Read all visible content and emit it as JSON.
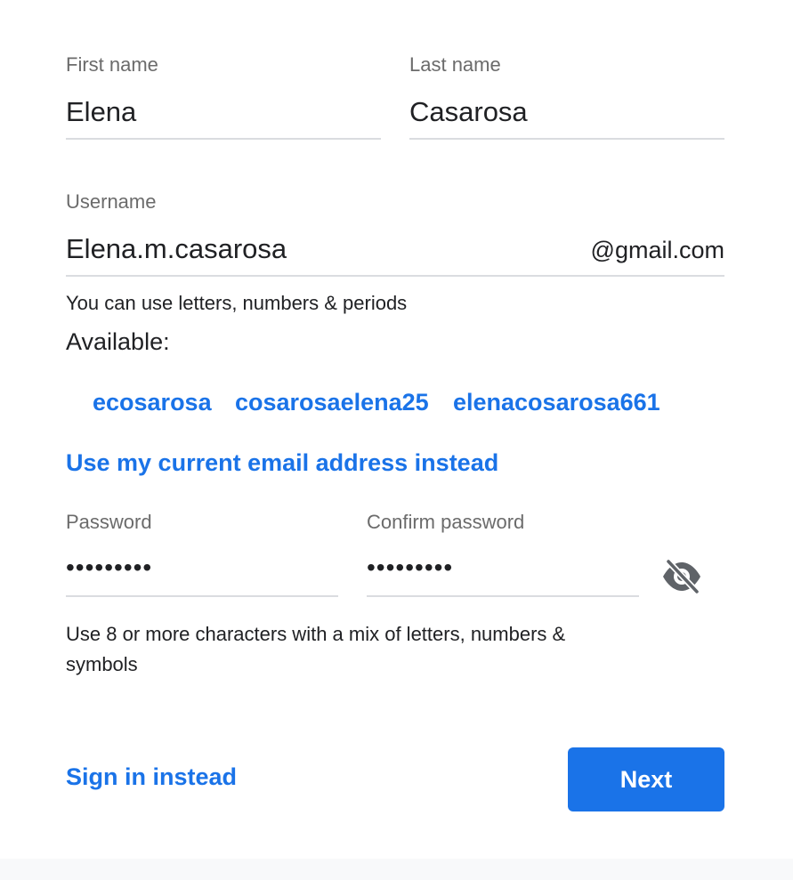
{
  "form": {
    "first_name": {
      "label": "First name",
      "value": "Elena"
    },
    "last_name": {
      "label": "Last name",
      "value": "Casarosa"
    },
    "username": {
      "label": "Username",
      "value": "Elena.m.casarosa",
      "suffix": "@gmail.com",
      "hint": "You can use letters, numbers & periods"
    },
    "availability": {
      "heading": "Available:",
      "suggestions": [
        "ecosarosa",
        "cosarosaelena25",
        "elenacosarosa661"
      ]
    },
    "use_current_email_link": "Use my current email address instead",
    "password": {
      "label": "Password",
      "value": "•••••••••"
    },
    "confirm_password": {
      "label": "Confirm password",
      "value": "•••••••••"
    },
    "password_visibility_icon": "eye-off-icon",
    "password_hint": "Use 8 or more characters with a mix of letters, numbers & symbols"
  },
  "actions": {
    "sign_in_instead": "Sign in instead",
    "next": "Next"
  },
  "colors": {
    "accent": "#1a73e8",
    "label": "#6b6b6b",
    "text": "#202124",
    "underline": "#dadce0"
  }
}
